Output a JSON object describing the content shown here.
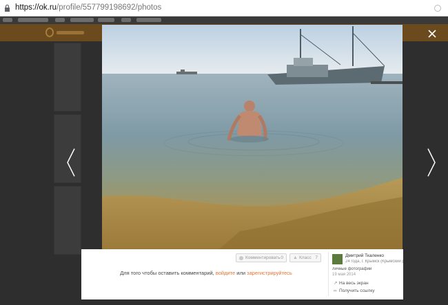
{
  "browser": {
    "url_host": "https://ok.ru",
    "url_path": "/profile/557799198692/photos",
    "lock_icon": "lock-icon"
  },
  "lightbox": {
    "close_icon": "close-icon",
    "prev_icon": "chevron-left-icon",
    "next_icon": "chevron-right-icon",
    "buttons": {
      "comments_label": "Комментировать",
      "comments_count": "0",
      "class_label": "Класс",
      "class_count": "7"
    },
    "login_prompt": {
      "before": "Для того чтобы оставить комментарий,",
      "login": "войдите",
      "middle": "или",
      "register": "зарегистрируйтесь"
    },
    "author": {
      "name": "Дмитрий Ткаленко",
      "info": "24 года, г. Крымск (Крымский рай..."
    },
    "album": "личные фотографии",
    "date": "19 мая 2014",
    "actions": {
      "fullscreen": "На весь экран",
      "get_link": "Получить ссылку"
    }
  },
  "colors": {
    "accent": "#eb722e",
    "overlay": "#2b2b2b",
    "ok_header": "#6b4a1e"
  }
}
